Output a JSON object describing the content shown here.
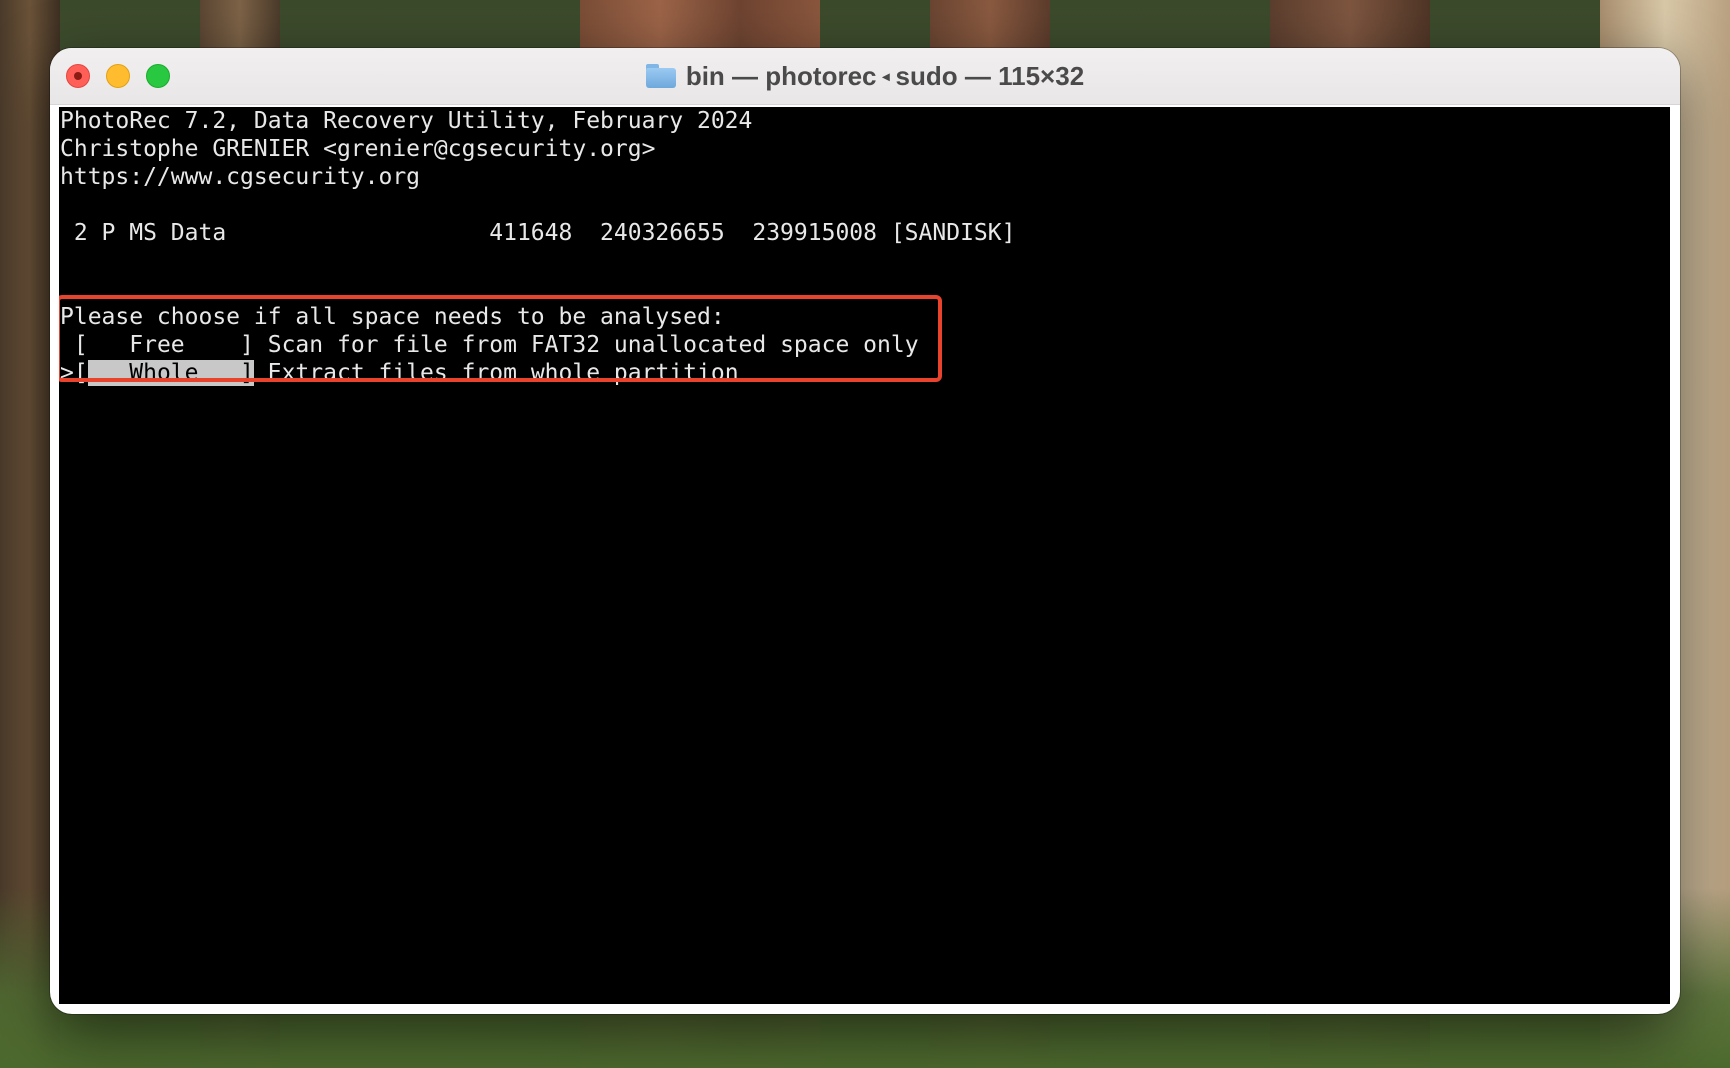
{
  "window": {
    "title_folder": "bin",
    "title_sep1": " — ",
    "title_app": "photorec",
    "title_arrow": "◂",
    "title_user": "sudo",
    "title_sep2": " — ",
    "title_size": "115×32"
  },
  "terminal": {
    "header": {
      "line1": "PhotoRec 7.2, Data Recovery Utility, February 2024",
      "line2": "Christophe GRENIER <grenier@cgsecurity.org>",
      "line3": "https://www.cgsecurity.org"
    },
    "partition": " 2 P MS Data                   411648  240326655  239915008 [SANDISK]",
    "prompt": "Please choose if all space needs to be analysed:",
    "options": [
      {
        "prefix": " [",
        "label": "   Free    ",
        "suffix": "]",
        "description": " Scan for file from FAT32 unallocated space only",
        "selected": false
      },
      {
        "prefix": ">[",
        "label": "   Whole   ",
        "suffix": "]",
        "description": " Extract files from whole partition",
        "selected": true
      }
    ]
  },
  "colors": {
    "terminal_bg": "#000000",
    "terminal_fg": "#e8e8e8",
    "selection_bg": "#c8c8c8",
    "annotation_border": "#e8432d"
  }
}
